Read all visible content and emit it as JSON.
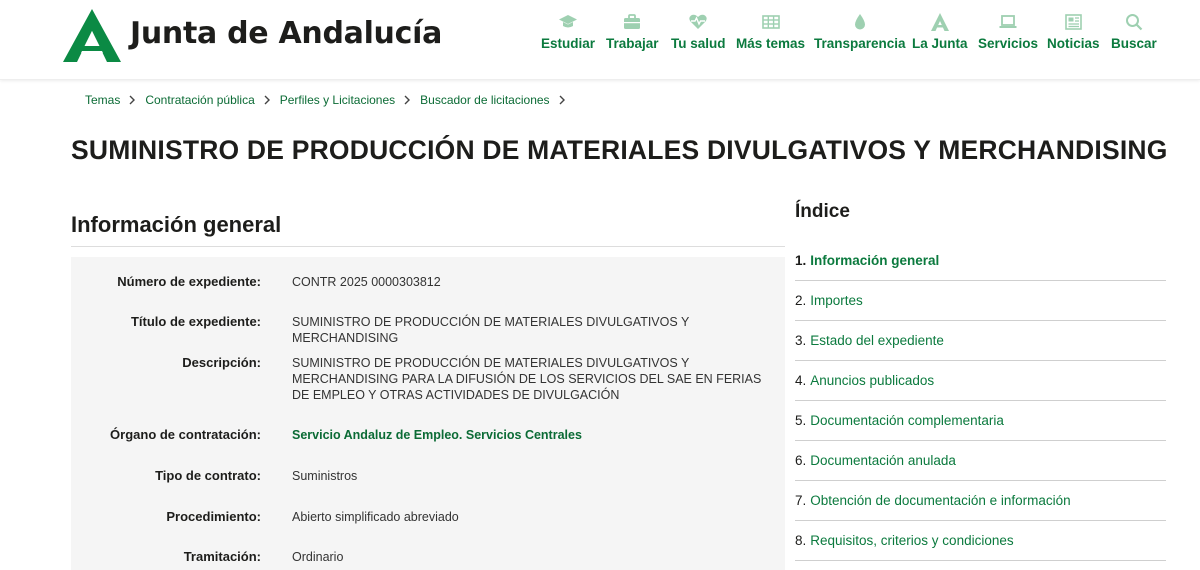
{
  "header": {
    "brand": "Junta de Andalucía",
    "nav": [
      {
        "label": "Estudiar",
        "icon": "graduation-cap-icon"
      },
      {
        "label": "Trabajar",
        "icon": "briefcase-icon"
      },
      {
        "label": "Tu salud",
        "icon": "heart-pulse-icon"
      },
      {
        "label": "Más temas",
        "icon": "grid-icon"
      },
      {
        "label": "Transparencia",
        "icon": "water-drop-icon"
      },
      {
        "label": "La Junta",
        "icon": "junta-logo-icon"
      },
      {
        "label": "Servicios",
        "icon": "laptop-icon"
      },
      {
        "label": "Noticias",
        "icon": "newspaper-icon"
      },
      {
        "label": "Buscar",
        "icon": "search-icon"
      }
    ]
  },
  "breadcrumb": [
    "Temas",
    "Contratación pública",
    "Perfiles y Licitaciones",
    "Buscador de licitaciones"
  ],
  "title": "SUMINISTRO DE PRODUCCIÓN DE MATERIALES DIVULGATIVOS Y MERCHANDISING",
  "section": {
    "heading": "Información general",
    "rows": [
      {
        "label": "Número de expediente:",
        "value": "CONTR 2025 0000303812"
      },
      {
        "label": "Título de expediente:",
        "value": "SUMINISTRO DE PRODUCCIÓN DE MATERIALES DIVULGATIVOS Y MERCHANDISING"
      },
      {
        "label": "Descripción:",
        "value": "SUMINISTRO DE PRODUCCIÓN DE MATERIALES DIVULGATIVOS Y MERCHANDISING PARA LA DIFUSIÓN DE LOS SERVICIOS DEL SAE EN FERIAS DE EMPLEO Y OTRAS ACTIVIDADES DE DIVULGACIÓN"
      },
      {
        "label": "Órgano de contratación:",
        "value": "Servicio Andaluz de Empleo. Servicios Centrales"
      },
      {
        "label": "Tipo de contrato:",
        "value": "Suministros"
      },
      {
        "label": "Procedimiento:",
        "value": "Abierto simplificado abreviado"
      },
      {
        "label": "Tramitación:",
        "value": "Ordinario"
      }
    ]
  },
  "index": {
    "title": "Índice",
    "items": [
      {
        "num": "1.",
        "label": "Información general"
      },
      {
        "num": "2.",
        "label": "Importes"
      },
      {
        "num": "3.",
        "label": "Estado del expediente"
      },
      {
        "num": "4.",
        "label": "Anuncios publicados"
      },
      {
        "num": "5.",
        "label": "Documentación complementaria"
      },
      {
        "num": "6.",
        "label": "Documentación anulada"
      },
      {
        "num": "7.",
        "label": "Obtención de documentación e información"
      },
      {
        "num": "8.",
        "label": "Requisitos, criterios y condiciones"
      }
    ]
  },
  "colors": {
    "brand_green": "#0b7a3e",
    "text_dark": "#1d1d1b",
    "panel_gray": "#f5f5f5"
  }
}
